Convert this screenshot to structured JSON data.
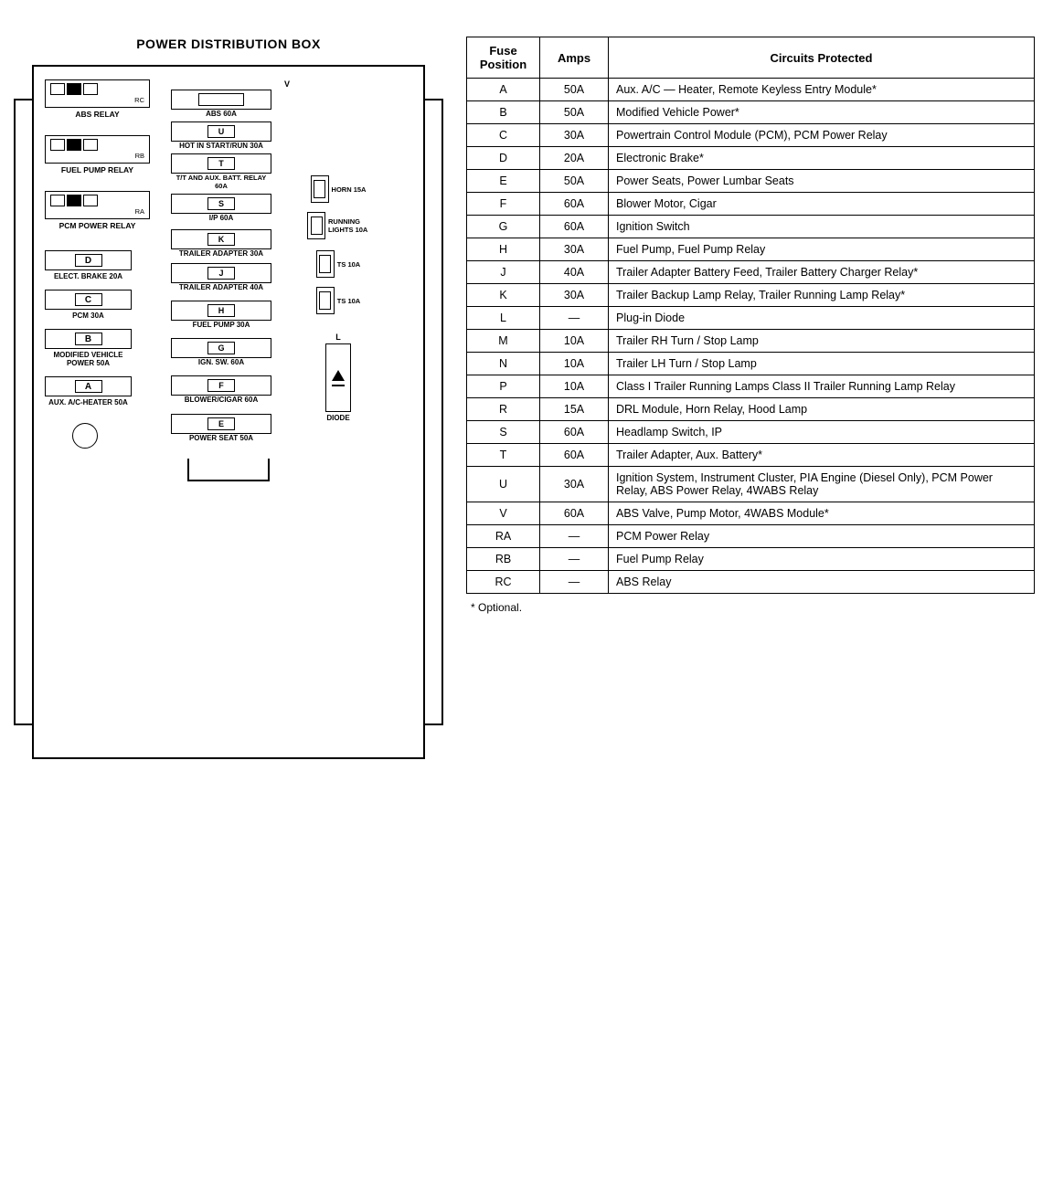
{
  "diagram": {
    "title": "POWER DISTRIBUTION BOX",
    "components": {
      "abs_relay": {
        "label": "ABS RELAY",
        "id": "RC"
      },
      "fuel_pump_relay": {
        "label": "FUEL PUMP RELAY",
        "id": "RB"
      },
      "pcm_power_relay": {
        "label": "PCM POWER RELAY",
        "id": "RA"
      },
      "abs_60a": {
        "label": "ABS 60A",
        "letter": "V"
      },
      "hot_in_start": {
        "label": "HOT IN START/RUN 30A"
      },
      "tt_aux_batt": {
        "label": "T/T AND AUX. BATT. RELAY 60A",
        "letter": "T"
      },
      "ip_60a": {
        "label": "I/P 60A",
        "letter": "S"
      },
      "horn_15a": {
        "label": "HORN 15A"
      },
      "trailer_adapter_30a": {
        "label": "TRAILER ADAPTER 30A",
        "letter": "K"
      },
      "running_lights_10a": {
        "label": "RUNNING LIGHTS 10A"
      },
      "trailer_adapter_40a": {
        "label": "TRAILER ADAPTER 40A",
        "letter": "J"
      },
      "ts_10a_1": {
        "label": "TS 10A"
      },
      "elect_brake_20a": {
        "label": "ELECT. BRAKE 20A",
        "letter": "D"
      },
      "fuel_pump_30a": {
        "label": "FUEL PUMP 30A",
        "letter": "H"
      },
      "ts_10a_2": {
        "label": "TS 10A"
      },
      "pcm_30a": {
        "label": "PCM 30A",
        "letter": "C"
      },
      "ign_sw_60a": {
        "label": "IGN. SW. 60A",
        "letter": "G"
      },
      "modified_vehicle": {
        "label": "MODIFIED VEHICLE POWER 50A",
        "letter": "B"
      },
      "blower_cigar": {
        "label": "BLOWER/CIGAR 60A",
        "letter": "F"
      },
      "aux_ac_heater": {
        "label": "AUX. A/C-HEATER 50A",
        "letter": "A"
      },
      "power_seat": {
        "label": "POWER SEAT 50A",
        "letter": "E"
      },
      "diode": {
        "label": "DIODE"
      },
      "l_fuse": {
        "label": "L"
      }
    }
  },
  "table": {
    "headers": {
      "col1": "Fuse\nPosition",
      "col1_line1": "Fuse",
      "col1_line2": "Position",
      "col2": "Amps",
      "col3": "Circuits Protected"
    },
    "rows": [
      {
        "position": "A",
        "amps": "50A",
        "circuits": "Aux. A/C — Heater, Remote Keyless Entry Module*"
      },
      {
        "position": "B",
        "amps": "50A",
        "circuits": "Modified Vehicle Power*"
      },
      {
        "position": "C",
        "amps": "30A",
        "circuits": "Powertrain Control Module (PCM), PCM Power Relay"
      },
      {
        "position": "D",
        "amps": "20A",
        "circuits": "Electronic Brake*"
      },
      {
        "position": "E",
        "amps": "50A",
        "circuits": "Power Seats, Power Lumbar Seats"
      },
      {
        "position": "F",
        "amps": "60A",
        "circuits": "Blower Motor, Cigar"
      },
      {
        "position": "G",
        "amps": "60A",
        "circuits": "Ignition Switch"
      },
      {
        "position": "H",
        "amps": "30A",
        "circuits": "Fuel Pump, Fuel Pump Relay"
      },
      {
        "position": "J",
        "amps": "40A",
        "circuits": "Trailer Adapter Battery Feed, Trailer Battery Charger Relay*"
      },
      {
        "position": "K",
        "amps": "30A",
        "circuits": "Trailer Backup Lamp Relay, Trailer Running Lamp Relay*"
      },
      {
        "position": "L",
        "amps": "—",
        "circuits": "Plug-in Diode"
      },
      {
        "position": "M",
        "amps": "10A",
        "circuits": "Trailer RH Turn / Stop Lamp"
      },
      {
        "position": "N",
        "amps": "10A",
        "circuits": "Trailer LH Turn / Stop Lamp"
      },
      {
        "position": "P",
        "amps": "10A",
        "circuits": "Class I Trailer Running Lamps\nClass II Trailer Running Lamp Relay"
      },
      {
        "position": "R",
        "amps": "15A",
        "circuits": "DRL Module, Horn Relay, Hood Lamp"
      },
      {
        "position": "S",
        "amps": "60A",
        "circuits": "Headlamp Switch, IP"
      },
      {
        "position": "T",
        "amps": "60A",
        "circuits": "Trailer Adapter, Aux. Battery*"
      },
      {
        "position": "U",
        "amps": "30A",
        "circuits": "Ignition System, Instrument Cluster, PIA Engine (Diesel Only), PCM Power Relay, ABS Power Relay, 4WABS Relay"
      },
      {
        "position": "V",
        "amps": "60A",
        "circuits": "ABS Valve, Pump Motor, 4WABS Module*"
      },
      {
        "position": "RA",
        "amps": "—",
        "circuits": "PCM Power Relay"
      },
      {
        "position": "RB",
        "amps": "—",
        "circuits": "Fuel Pump Relay"
      },
      {
        "position": "RC",
        "amps": "—",
        "circuits": "ABS Relay"
      }
    ],
    "note": "* Optional."
  }
}
